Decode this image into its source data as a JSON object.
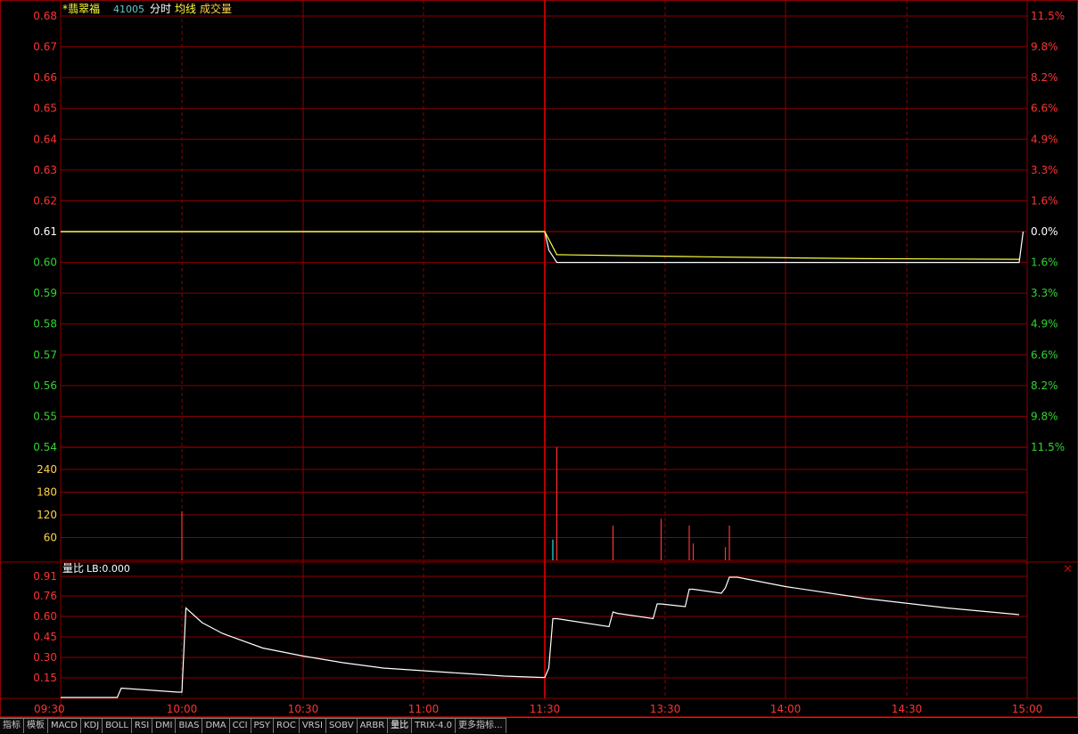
{
  "header": {
    "stock_name": "*翡翠福",
    "stock_code": "41005",
    "label_timeshare": "分时",
    "label_avg": "均线",
    "label_volume": "成交量"
  },
  "colors": {
    "grid": "#8b0000",
    "up": "#ff3232",
    "down": "#32d232",
    "neutral": "#ffffff",
    "price_line": "#ffffff",
    "avg_line": "#ffff3c",
    "volume_label": "#ffd24a",
    "volume_up": "#ff3232",
    "volume_down": "#32dcdc"
  },
  "chart_data": [
    {
      "type": "line",
      "name": "price-panel",
      "x_ticks": [
        "09:30",
        "10:00",
        "10:30",
        "11:00",
        "11:30",
        "13:30",
        "14:00",
        "14:30",
        "15:00"
      ],
      "price_ticks": [
        "0.68",
        "0.67",
        "0.66",
        "0.65",
        "0.64",
        "0.63",
        "0.62",
        "0.61",
        "0.60",
        "0.59",
        "0.58",
        "0.57",
        "0.56",
        "0.55",
        "0.54"
      ],
      "pct_ticks": [
        "11.5%",
        "9.8%",
        "8.2%",
        "6.6%",
        "4.9%",
        "3.3%",
        "1.6%",
        "0.0%",
        "1.6%",
        "3.3%",
        "4.9%",
        "6.6%",
        "8.2%",
        "9.8%",
        "11.5%"
      ],
      "prev_close": 0.61,
      "ylim": [
        0.54,
        0.68
      ],
      "series": [
        {
          "key": "price",
          "x": [
            0,
            120,
            121,
            123,
            238,
            239
          ],
          "y": [
            0.61,
            0.61,
            0.604,
            0.6,
            0.6,
            0.61
          ]
        },
        {
          "key": "avg",
          "x": [
            0,
            120,
            123,
            140,
            160,
            180,
            200,
            238
          ],
          "y": [
            0.61,
            0.61,
            0.6025,
            0.6022,
            0.6018,
            0.6015,
            0.6012,
            0.601
          ]
        }
      ]
    },
    {
      "type": "bar",
      "name": "volume-panel",
      "y_ticks": [
        "240",
        "180",
        "120",
        "60"
      ],
      "ylim": [
        0,
        300
      ],
      "bars": [
        {
          "x": 30,
          "v": 130,
          "dir": "up"
        },
        {
          "x": 122,
          "v": 55,
          "dir": "down"
        },
        {
          "x": 123,
          "v": 300,
          "dir": "up"
        },
        {
          "x": 137,
          "v": 92,
          "dir": "up"
        },
        {
          "x": 149,
          "v": 110,
          "dir": "up"
        },
        {
          "x": 156,
          "v": 92,
          "dir": "up"
        },
        {
          "x": 157,
          "v": 45,
          "dir": "up"
        },
        {
          "x": 165,
          "v": 35,
          "dir": "up"
        },
        {
          "x": 166,
          "v": 92,
          "dir": "up"
        }
      ]
    },
    {
      "type": "line",
      "name": "volume-ratio-panel",
      "title": "量比",
      "indicator_label": "LB:0.000",
      "y_ticks": [
        "0.91",
        "0.76",
        "0.60",
        "0.45",
        "0.30",
        "0.15"
      ],
      "ylim": [
        0,
        0.99
      ],
      "series": [
        {
          "key": "lb",
          "x": [
            0,
            14,
            15,
            29,
            30,
            31,
            35,
            40,
            50,
            60,
            70,
            80,
            90,
            100,
            110,
            119,
            120,
            121,
            122,
            123,
            136,
            137,
            138,
            147,
            148,
            149,
            155,
            156,
            157,
            164,
            165,
            166,
            168,
            180,
            200,
            220,
            238
          ],
          "y": [
            0.0,
            0.0,
            0.07,
            0.04,
            0.04,
            0.67,
            0.56,
            0.48,
            0.37,
            0.31,
            0.26,
            0.22,
            0.2,
            0.18,
            0.16,
            0.15,
            0.15,
            0.22,
            0.59,
            0.59,
            0.53,
            0.64,
            0.63,
            0.59,
            0.7,
            0.7,
            0.68,
            0.81,
            0.81,
            0.78,
            0.82,
            0.9,
            0.9,
            0.83,
            0.74,
            0.67,
            0.62
          ]
        }
      ]
    }
  ],
  "toolbar": {
    "tabs": [
      "指标",
      "模板",
      "MACD",
      "KDJ",
      "BOLL",
      "RSI",
      "DMI",
      "BIAS",
      "DMA",
      "CCI",
      "PSY",
      "ROC",
      "VRSI",
      "SOBV",
      "ARBR",
      "量比",
      "TRIX-4.0",
      "更多指标..."
    ]
  },
  "icons": {
    "close": "close-icon"
  }
}
